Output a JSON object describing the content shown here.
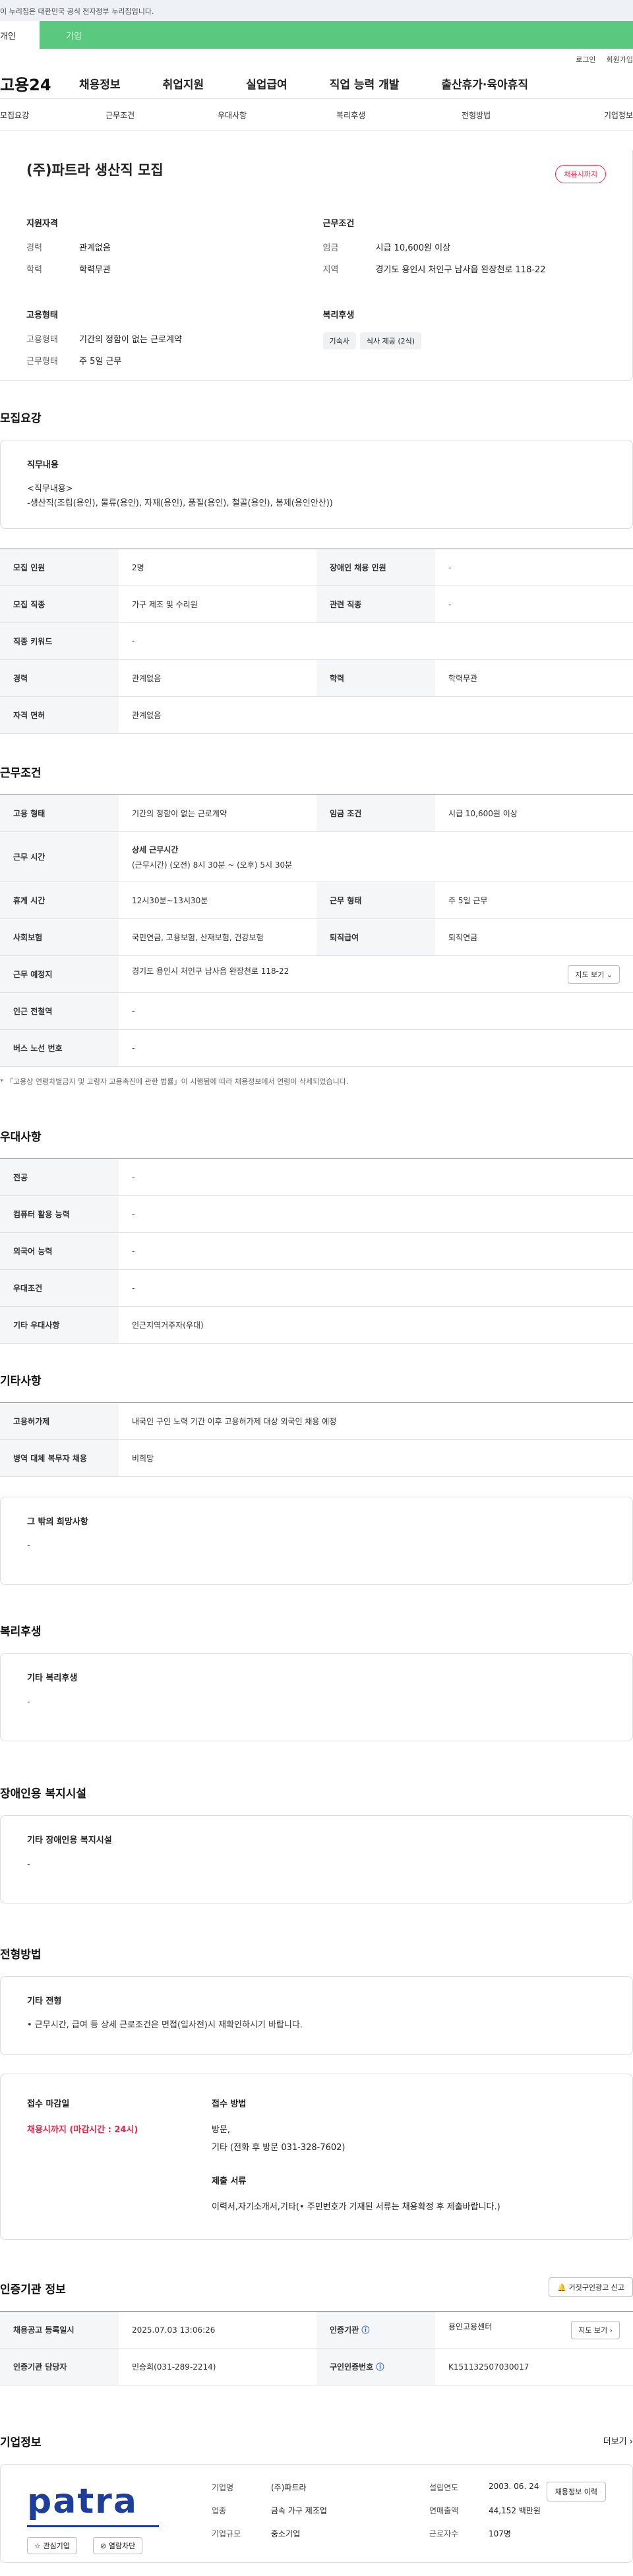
{
  "gov_banner": "이 누리집은 대한민국 공식 전자정부 누리집입니다.",
  "user_tabs": {
    "individual": "개인",
    "corporate": "기업"
  },
  "util_links": [
    "로그인",
    "회원가입"
  ],
  "gnb": {
    "logo": "고용24",
    "items": [
      "채용정보",
      "취업지원",
      "실업급여",
      "직업 능력 개발",
      "출산휴가·육아휴직"
    ]
  },
  "subnav": [
    "모집요강",
    "근무조건",
    "우대사항",
    "복리후생",
    "전형방법",
    "기업정보"
  ],
  "summary": {
    "title": "(주)파트라 생산직 모집",
    "badge": "채용시까지",
    "qualification": {
      "heading": "지원자격",
      "career_k": "경력",
      "career_v": "관계없음",
      "edu_k": "학력",
      "edu_v": "학력무관"
    },
    "conditions": {
      "heading": "근무조건",
      "wage_k": "임금",
      "wage_v": "시급 10,600원 이상",
      "region_k": "지역",
      "region_v": "경기도 용인시 처인구 남사읍 완장천로 118-22"
    },
    "employment": {
      "heading": "고용형태",
      "type_k": "고용형태",
      "type_v": "기간의 정함이 없는 근로계약",
      "form_k": "근무형태",
      "form_v": "주 5일 근무"
    },
    "welfare": {
      "heading": "복리후생",
      "chips": [
        "기숙사",
        "식사 제공 (2식)"
      ]
    }
  },
  "recruit": {
    "title": "모집요강",
    "job_heading": "직무내용",
    "job_text1": "<직무내용>",
    "job_text2": "-생산직(조립(용인), 물류(용인), 자재(용인), 품질(용인), 철골(용인), 봉제(용인안산))",
    "rows": [
      {
        "h1": "모집 인원",
        "v1": "2명",
        "h2": "장애인 채용 인원",
        "v2": "-"
      },
      {
        "h1": "모집 직종",
        "v1": "가구 제조 및 수리원",
        "h2": "관련 직종",
        "v2": "-"
      },
      {
        "h1": "직종 키워드",
        "v1": "-"
      },
      {
        "h1": "경력",
        "v1": "관계없음",
        "h2": "학력",
        "v2": "학력무관"
      },
      {
        "h1": "자격 면허",
        "v1": "관계없음"
      }
    ]
  },
  "work": {
    "title": "근무조건",
    "employment_h": "고용 형태",
    "employment_v": "기간의 정함이 없는 근로계약",
    "wage_h": "임금 조건",
    "wage_v": "시급 10,600원 이상",
    "time_h": "근무 시간",
    "time_sub": "상세 근무시간",
    "time_v": "(근무시간) (오전) 8시 30분 ~ (오후) 5시 30분",
    "rest_h": "휴게 시간",
    "rest_v": "12시30분~13시30분",
    "form_h": "근무 형태",
    "form_v": "주 5일 근무",
    "ins_h": "사회보험",
    "ins_v": "국민연금, 고용보험, 산재보험, 건강보험",
    "sev_h": "퇴직급여",
    "sev_v": "퇴직연금",
    "place_h": "근무 예정지",
    "place_v": "경기도 용인시 처인구 남사읍 완장천로 118-22",
    "map_btn": "지도 보기",
    "subway_h": "인근 전철역",
    "subway_v": "-",
    "bus_h": "버스 노선 번호",
    "bus_v": "-",
    "note": "* 「고용상 연령차별금지 및 고령자 고용촉진에 관한 법률」이 시행됨에 따라 채용정보에서 연령이 삭제되었습니다."
  },
  "prefer": {
    "title": "우대사항",
    "rows": [
      {
        "h": "전공",
        "v": "-"
      },
      {
        "h": "컴퓨터 활용 능력",
        "v": "-"
      },
      {
        "h": "외국어 능력",
        "v": "-"
      },
      {
        "h": "우대조건",
        "v": "-"
      },
      {
        "h": "기타 우대사항",
        "v": "인근지역거주자(우대)"
      }
    ]
  },
  "etc": {
    "title": "기타사항",
    "rows": [
      {
        "h": "고용허가제",
        "v": "내국인 구인 노력 기간 이후 고용허가제 대상 외국인 채용 예정"
      },
      {
        "h": "병역 대체 복무자 채용",
        "v": "비희망"
      }
    ],
    "wish_heading": "그 밖의 희망사항",
    "wish_v": "-"
  },
  "welfare": {
    "title": "복리후생",
    "heading": "기타 복리후생",
    "v": "-"
  },
  "disabled": {
    "title": "장애인용 복지시설",
    "heading": "기타 장애인용 복지시설",
    "v": "-"
  },
  "selection": {
    "title": "전형방법",
    "heading": "기타 전형",
    "v": "• 근무시간, 급여 등 상세 근로조건은 면접(입사전)시 재확인하시기 바랍니다.",
    "deadline_h": "접수 마감일",
    "deadline_v": "채용시까지 (마감시간 : 24시)",
    "method_h": "접수 방법",
    "method_v1": "방문,",
    "method_v2": "기타 (전화 후 방문 031-328-7602)",
    "docs_h": "제출 서류",
    "docs_v": "이력서,자기소개서,기타(• 주민번호가 기재된 서류는 채용확정 후 제출바랍니다.)"
  },
  "agency": {
    "title": "인증기관 정보",
    "report_btn": "거짓구인광고 신고",
    "reg_h": "채용공고 등록일시",
    "reg_v": "2025.07.03 13:06:26",
    "org_h": "인증기관",
    "org_v": "용인고용센터",
    "map_btn": "지도 보기",
    "mgr_h": "인증기관 담당자",
    "mgr_v": "민승희(031-289-2214)",
    "num_h": "구인인증번호",
    "num_v": "K151132507030017"
  },
  "company": {
    "title": "기업정보",
    "more": "더보기",
    "logo_text": "patra",
    "fav_btn": "관심기업",
    "block_btn": "열람차단",
    "history_btn": "채용정보 이력",
    "name_k": "기업명",
    "name_v": "(주)파트라",
    "founded_k": "설립연도",
    "founded_v": "2003. 06. 24",
    "industry_k": "업종",
    "industry_v": "금속 가구 제조업",
    "sales_k": "연매출액",
    "sales_v": "44,152 백만원",
    "scale_k": "기업규모",
    "scale_v": "중소기업",
    "emp_k": "근로자수",
    "emp_v": "107명"
  }
}
